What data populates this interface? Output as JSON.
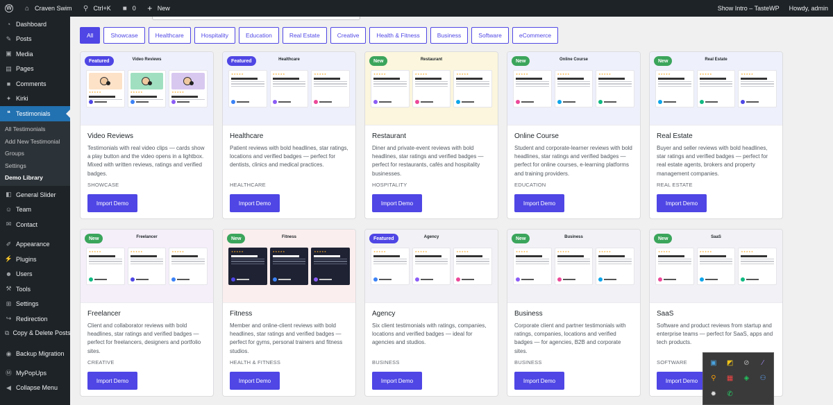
{
  "adminbar": {
    "site_name": "Craven Swim",
    "shortcut": "Ctrl+K",
    "comments_count": "0",
    "new_label": "New",
    "show_intro": "Show Intro – TasteWP",
    "howdy": "Howdy, admin"
  },
  "sidebar": {
    "items": [
      {
        "label": "Dashboard",
        "icon": "dashboard-icon",
        "glyph": "◔"
      },
      {
        "label": "Posts",
        "icon": "pin-icon",
        "glyph": "✎"
      },
      {
        "label": "Media",
        "icon": "media-icon",
        "glyph": "▣"
      },
      {
        "label": "Pages",
        "icon": "pages-icon",
        "glyph": "▤"
      },
      {
        "label": "Comments",
        "icon": "comment-icon",
        "glyph": "■"
      },
      {
        "label": "Kirki",
        "icon": "kirki-icon",
        "glyph": "✦"
      },
      {
        "label": "Testimonials",
        "icon": "testimonials-icon",
        "glyph": "❝"
      }
    ],
    "submenu": [
      "All Testimonials",
      "Add New Testimonial",
      "Groups",
      "Settings",
      "Demo Library"
    ],
    "items2": [
      {
        "label": "General Slider",
        "icon": "slider-icon",
        "glyph": "◧"
      },
      {
        "label": "Team",
        "icon": "team-icon",
        "glyph": "☺"
      },
      {
        "label": "Contact",
        "icon": "contact-icon",
        "glyph": "✉"
      }
    ],
    "items3": [
      {
        "label": "Appearance",
        "icon": "appearance-icon",
        "glyph": "✐"
      },
      {
        "label": "Plugins",
        "icon": "plugins-icon",
        "glyph": "⚡"
      },
      {
        "label": "Users",
        "icon": "users-icon",
        "glyph": "☻"
      },
      {
        "label": "Tools",
        "icon": "tools-icon",
        "glyph": "⚒"
      },
      {
        "label": "Settings",
        "icon": "settings-icon",
        "glyph": "⊞"
      },
      {
        "label": "Redirection",
        "icon": "redirection-icon",
        "glyph": "↪"
      }
    ],
    "copy_delete": "Copy & Delete Posts",
    "backup": "Backup Migration",
    "mypopups": "MyPopUps",
    "collapse": "Collapse Menu"
  },
  "filters": [
    "All",
    "Showcase",
    "Healthcare",
    "Hospitality",
    "Education",
    "Real Estate",
    "Creative",
    "Health & Fitness",
    "Business",
    "Software",
    "eCommerce"
  ],
  "import_label": "Import Demo",
  "cards": [
    {
      "title": "Video Reviews",
      "badge": "Featured",
      "preview_title": "Video Reviews",
      "desc": "Testimonials with real video clips — cards show a play button and the video opens in a lightbox. Mixed with written reviews, ratings and verified badges.",
      "category": "SHOWCASE",
      "bg": "#eef0fb"
    },
    {
      "title": "Healthcare",
      "badge": "Featured",
      "preview_title": "Healthcare",
      "desc": "Patient reviews with bold headlines, star ratings, locations and verified badges — perfect for dentists, clinics and medical practices.",
      "category": "HEALTHCARE",
      "bg": "#eef0fb"
    },
    {
      "title": "Restaurant",
      "badge": "New",
      "preview_title": "Restaurant",
      "desc": "Diner and private-event reviews with bold headlines, star ratings and verified badges — perfect for restaurants, cafés and hospitality businesses.",
      "category": "HOSPITALITY",
      "bg": "#fbf6dd"
    },
    {
      "title": "Online Course",
      "badge": "New",
      "preview_title": "Online Course",
      "desc": "Student and corporate-learner reviews with bold headlines, star ratings and verified badges — perfect for online courses, e-learning platforms and training providers.",
      "category": "EDUCATION",
      "bg": "#eef0fb"
    },
    {
      "title": "Real Estate",
      "badge": "New",
      "preview_title": "Real Estate",
      "desc": "Buyer and seller reviews with bold headlines, star ratings and verified badges — perfect for real estate agents, brokers and property management companies.",
      "category": "REAL ESTATE",
      "bg": "#eef0fb"
    },
    {
      "title": "Freelancer",
      "badge": "New",
      "preview_title": "Freelancer",
      "desc": "Client and collaborator reviews with bold headlines, star ratings and verified badges — perfect for freelancers, designers and portfolio sites.",
      "category": "CREATIVE",
      "bg": "#f5effa"
    },
    {
      "title": "Fitness",
      "badge": "New",
      "preview_title": "Fitness",
      "desc": "Member and online-client reviews with bold headlines, star ratings and verified badges — perfect for gyms, personal trainers and fitness studios.",
      "category": "HEALTH & FITNESS",
      "bg": "#fbeeee"
    },
    {
      "title": "Agency",
      "badge": "Featured",
      "preview_title": "Agency",
      "desc": "Six client testimonials with ratings, companies, locations and verified badges — ideal for agencies and studios.",
      "category": "BUSINESS",
      "bg": "#f2f2f6"
    },
    {
      "title": "Business",
      "badge": "New",
      "preview_title": "Business",
      "desc": "Corporate client and partner testimonials with ratings, companies, locations and verified badges — for agencies, B2B and corporate sites.",
      "category": "BUSINESS",
      "bg": "#f2f2f6"
    },
    {
      "title": "SaaS",
      "badge": "New",
      "preview_title": "SaaS",
      "desc": "Software and product reviews from startup and enterprise teams — perfect for SaaS, apps and tech products.",
      "category": "SOFTWARE",
      "bg": "#f2f2f6"
    }
  ],
  "tray": [
    "app-icon-1",
    "app-icon-2",
    "app-icon-3",
    "app-icon-4",
    "app-icon-5",
    "app-icon-6",
    "app-icon-7",
    "app-icon-8",
    "app-icon-9",
    "whatsapp-icon"
  ]
}
